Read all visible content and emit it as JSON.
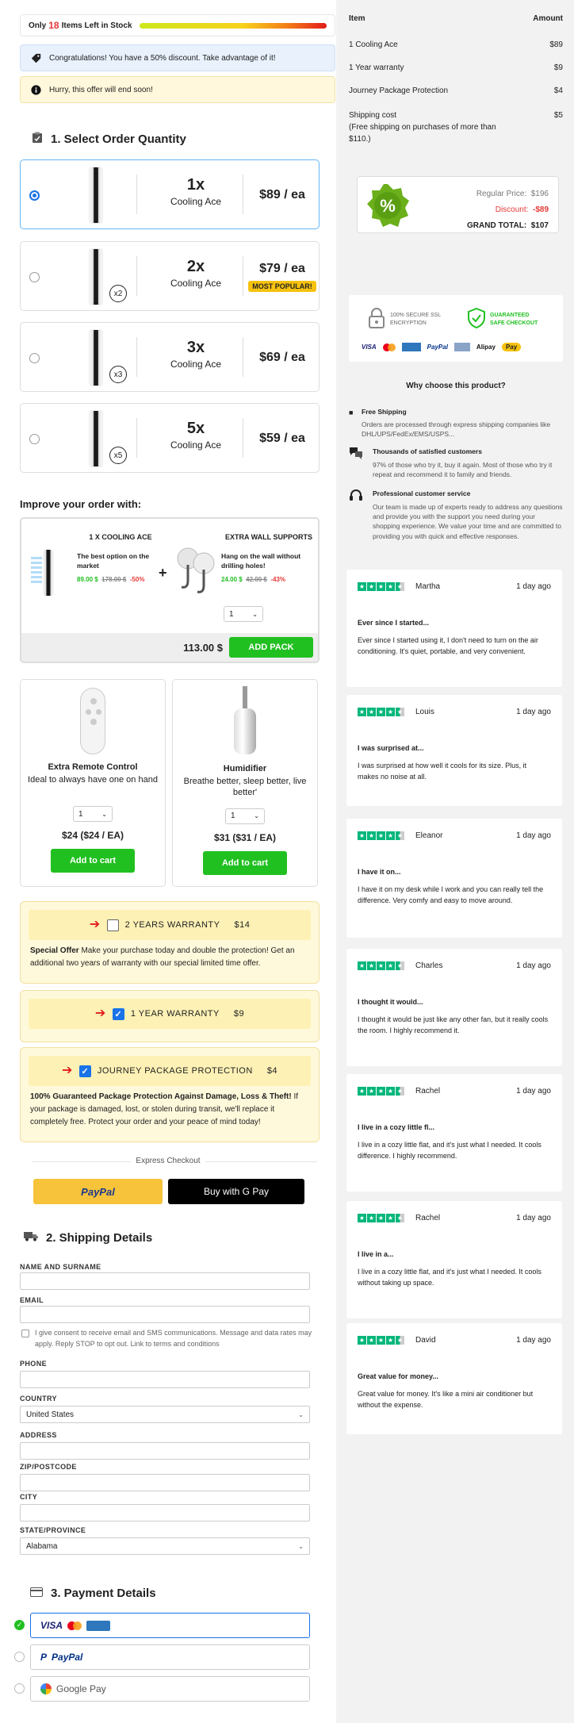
{
  "stock": {
    "prefix": "Only",
    "count": "18",
    "suffix": "Items Left in Stock"
  },
  "notices": {
    "discount": "Congratulations! You have a 50% discount. Take advantage of it!",
    "hurry": "Hurry, this offer will end soon!"
  },
  "quantity": {
    "title": "1. Select Order Quantity",
    "options": [
      {
        "mult": "1x",
        "name": "Cooling Ace",
        "price": "$89 / ea",
        "badge": "",
        "popular": ""
      },
      {
        "mult": "2x",
        "name": "Cooling Ace",
        "price": "$79 / ea",
        "badge": "x2",
        "popular": "MOST POPULAR!"
      },
      {
        "mult": "3x",
        "name": "Cooling Ace",
        "price": "$69 / ea",
        "badge": "x3",
        "popular": ""
      },
      {
        "mult": "5x",
        "name": "Cooling Ace",
        "price": "$59 / ea",
        "badge": "x5",
        "popular": ""
      }
    ]
  },
  "improve": {
    "title": "Improve your order with:",
    "bundle": {
      "item1_title": "1 X COOLING ACE",
      "item1_desc": "The best option on the market",
      "item1_price": "89.00 $",
      "item1_old": "178.00 $",
      "item1_off": "-50%",
      "item2_title": "EXTRA WALL SUPPORTS",
      "item2_desc": "Hang on the wall without drilling holes!",
      "item2_price": "24.00 $",
      "item2_old": "42.00 $",
      "item2_off": "-43%",
      "qty": "1",
      "total": "113.00 $",
      "button": "ADD PACK"
    },
    "addons": [
      {
        "name": "Extra Remote Control",
        "desc": "Ideal to always have one on hand",
        "qty": "1",
        "price": "$24 ($24 / EA)",
        "button": "Add to cart"
      },
      {
        "name": "Humidifier",
        "desc": "Breathe better, sleep better, live better'",
        "qty": "1",
        "price": "$31 ($31 / EA)",
        "button": "Add to cart"
      }
    ]
  },
  "warranty": {
    "two_year": {
      "label": "2 YEARS WARRANTY",
      "price": "$14",
      "checked": false,
      "body_bold": "Special Offer",
      "body": " Make your purchase today and double the protection! Get an additional two years of warranty with our special limited time offer."
    },
    "one_year": {
      "label": "1 YEAR WARRANTY",
      "price": "$9",
      "checked": true
    },
    "protection": {
      "label": "JOURNEY PACKAGE PROTECTION",
      "price": "$4",
      "checked": true,
      "body_bold": "100% Guaranteed Package Protection Against Damage, Loss & Theft!",
      "body": " If your package is damaged, lost, or stolen during transit, we'll replace it completely free. Protect your order and your peace of mind today!"
    }
  },
  "express": {
    "label": "Express Checkout",
    "paypal": "PayPal",
    "gpay": "Buy with G Pay"
  },
  "shipping": {
    "title": "2. Shipping Details",
    "name_label": "NAME AND SURNAME",
    "email_label": "EMAIL",
    "consent": "I give consent to receive email and SMS communications. Message and data rates may apply. Reply STOP to opt out. Link to terms and conditions",
    "phone_label": "PHONE",
    "country_label": "COUNTRY",
    "country_value": "United States",
    "address_label": "ADDRESS",
    "zip_label": "ZIP/POSTCODE",
    "city_label": "CITY",
    "state_label": "STATE/PROVINCE",
    "state_value": "Alabama"
  },
  "payment": {
    "title": "3. Payment Details",
    "card": "VISA",
    "paypal": "PayPal",
    "gpay": "Google Pay"
  },
  "summary": {
    "col_item": "Item",
    "col_amount": "Amount",
    "rows": [
      {
        "item": "1 Cooling Ace",
        "amount": "$89"
      },
      {
        "item": "1 Year warranty",
        "amount": "$9"
      },
      {
        "item": "Journey Package Protection",
        "amount": "$4"
      }
    ],
    "shipping_label": "Shipping cost",
    "shipping_note": "(Free shipping on purchases of more than $110.)",
    "shipping_amount": "$5",
    "regular_label": "Regular Price:",
    "regular_value": "$196",
    "discount_label": "Discount:",
    "discount_value": "-$89",
    "total_label": "GRAND TOTAL:",
    "total_value": "$107"
  },
  "trust": {
    "secure": "100% SECURE SSL ENCRYPTION",
    "guaranteed": "GUARANTEED SAFE CHECKOUT",
    "logos": [
      "VISA",
      "MC",
      "AMEX",
      "PayPal",
      "BANK",
      "Alipay",
      "Pay"
    ]
  },
  "why": {
    "title": "Why choose this product?",
    "items": [
      {
        "title": "Free Shipping",
        "text": "Orders are processed through express shipping companies like DHL/UPS/FedEx/EMS/USPS..."
      },
      {
        "title": "Thousands of satisfied customers",
        "text": "97% of those who try it, buy it again. Most of those who try it repeat and recommend it to family and friends."
      },
      {
        "title": "Professional customer service",
        "text": "Our team is made up of experts ready to address any questions and provide you with the support you need during your shopping experience. We value your time and are committed to providing you with quick and effective responses."
      }
    ]
  },
  "reviews": [
    {
      "name": "Martha",
      "date": "1 day ago",
      "headline": "Ever since I started...",
      "text": "Ever since I started using it, I don't need to turn on the air conditioning. It's quiet, portable, and very convenient."
    },
    {
      "name": "Louis",
      "date": "1 day ago",
      "headline": "I was surprised at...",
      "text": "I was surprised at how well it cools for its size. Plus, it makes no noise at all."
    },
    {
      "name": "Eleanor",
      "date": "1 day ago",
      "headline": "I have it on...",
      "text": "I have it on my desk while I work and you can really tell the difference. Very comfy and easy to move around."
    },
    {
      "name": "Charles",
      "date": "1 day ago",
      "headline": "I thought it would...",
      "text": "I thought it would be just like any other fan, but it really cools the room. I highly recommend it."
    },
    {
      "name": "Rachel",
      "date": "1 day ago",
      "headline": "I live in a cozy little fl...",
      "text": "I live in a cozy little flat, and it's just what I needed. It cools difference. I highly recommend."
    },
    {
      "name": "Rachel",
      "date": "1 day ago",
      "headline": "I live in a...",
      "text": "I live in a cozy little flat, and it's just what I needed. It cools without taking up space."
    },
    {
      "name": "David",
      "date": "1 day ago",
      "headline": "Great value for money...",
      "text": "Great value for money. It's like a mini air conditioner but without the expense."
    }
  ],
  "colors": {
    "accent_green": "#21c021",
    "star_green": "#00b67a",
    "alert_red": "#e53935",
    "select_blue": "#1a73e8"
  }
}
